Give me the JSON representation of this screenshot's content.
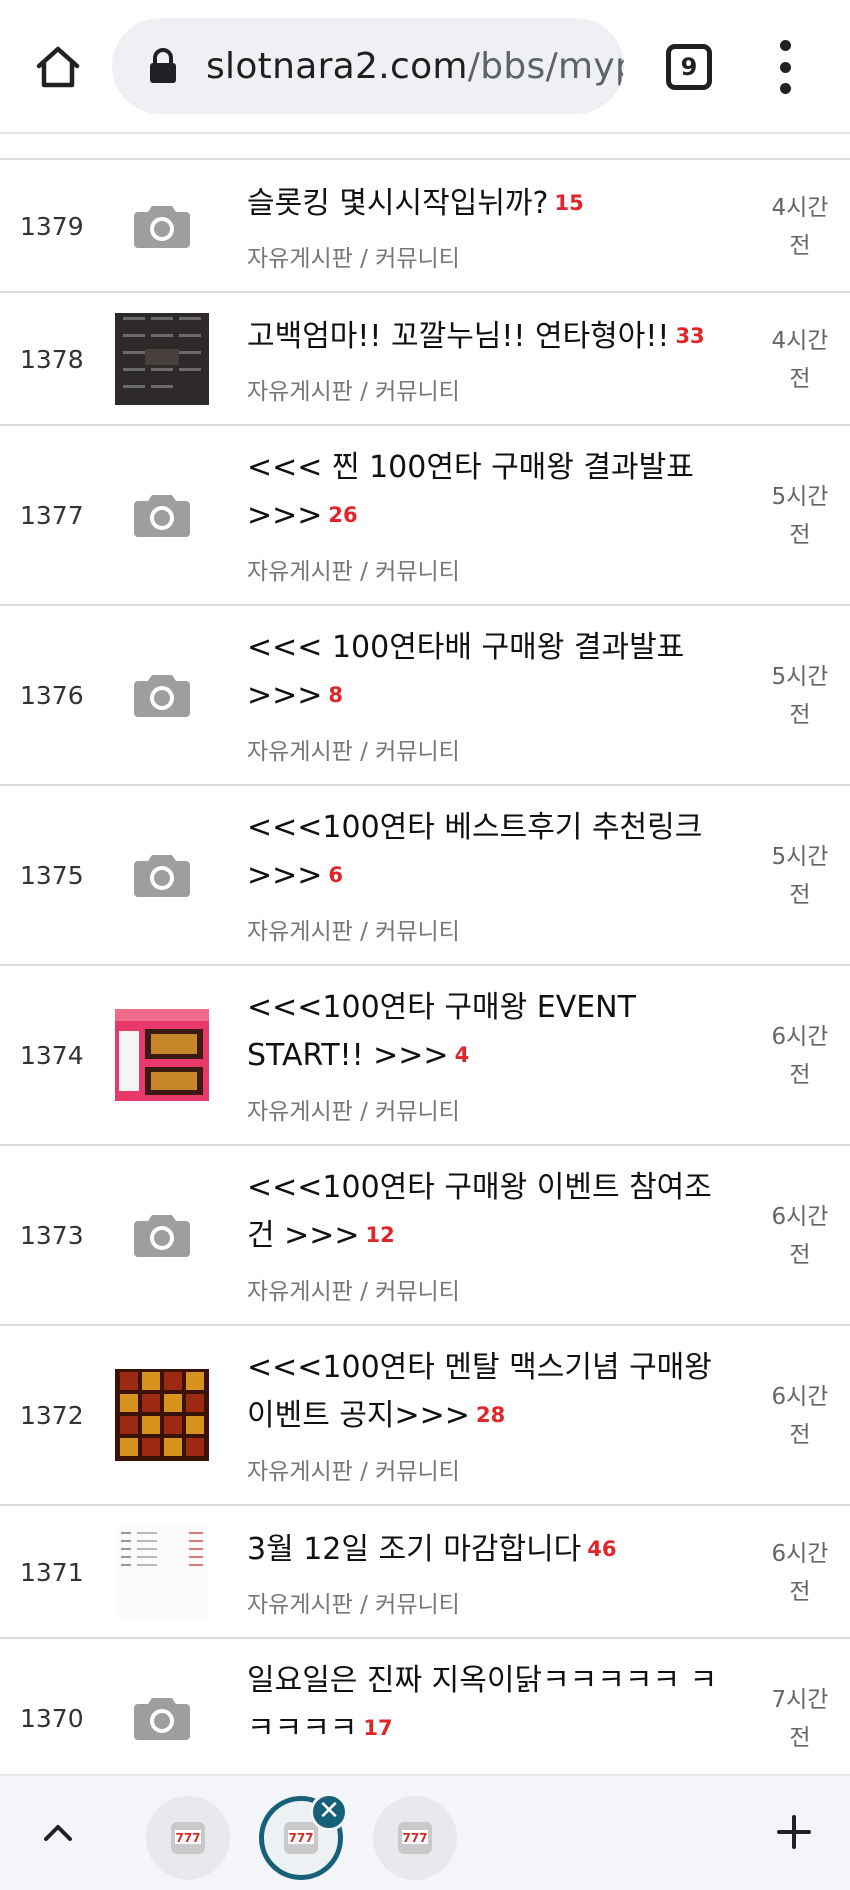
{
  "browser": {
    "url_host": "slotnara2.com",
    "url_path": "/bbs/myp",
    "tab_count": "9"
  },
  "posts": [
    {
      "num": "1379",
      "title": "슬롯킹 몇시시작입뉘까?",
      "comments": "15",
      "category": "자유게시판 / 커뮤니티",
      "time_l1": "4시간",
      "time_l2": "전",
      "thumb": "camera"
    },
    {
      "num": "1378",
      "title": "고백엄마!! 꼬깔누님!! 연타형아!!",
      "comments": "33",
      "category": "자유게시판 / 커뮤니티",
      "time_l1": "4시간",
      "time_l2": "전",
      "thumb": "dark-image"
    },
    {
      "num": "1377",
      "title": "<<< 찐 100연타 구매왕 결과발표 >>>",
      "comments": "26",
      "category": "자유게시판 / 커뮤니티",
      "time_l1": "5시간",
      "time_l2": "전",
      "thumb": "camera"
    },
    {
      "num": "1376",
      "title": "<<< 100연타배 구매왕 결과발표 >>>",
      "comments": "8",
      "category": "자유게시판 / 커뮤니티",
      "time_l1": "5시간",
      "time_l2": "전",
      "thumb": "camera"
    },
    {
      "num": "1375",
      "title": "<<<100연타 베스트후기 추천링크 >>>",
      "comments": "6",
      "category": "자유게시판 / 커뮤니티",
      "time_l1": "5시간",
      "time_l2": "전",
      "thumb": "camera"
    },
    {
      "num": "1374",
      "title": "<<<100연타 구매왕 EVENT START!! >>>",
      "comments": "4",
      "category": "자유게시판 / 커뮤니티",
      "time_l1": "6시간",
      "time_l2": "전",
      "thumb": "pink-image"
    },
    {
      "num": "1373",
      "title": "<<<100연타 구매왕 이벤트 참여조건 >>>",
      "comments": "12",
      "category": "자유게시판 / 커뮤니티",
      "time_l1": "6시간",
      "time_l2": "전",
      "thumb": "camera"
    },
    {
      "num": "1372",
      "title": "<<<100연타 멘탈 맥스기념 구매왕 이벤트 공지>>>",
      "comments": "28",
      "category": "자유게시판 / 커뮤니티",
      "time_l1": "6시간",
      "time_l2": "전",
      "thumb": "slot-image"
    },
    {
      "num": "1371",
      "title": "3월 12일 조기 마감합니다",
      "comments": "46",
      "category": "자유게시판 / 커뮤니티",
      "time_l1": "6시간",
      "time_l2": "전",
      "thumb": "list-image"
    },
    {
      "num": "1370",
      "title": "일요일은 진짜 지옥이닭ㅋㅋㅋㅋㅋ ㅋㅋㅋㅋㅋ",
      "comments": "17",
      "category": "자유게시판 / 커뮤니티",
      "time_l1": "7시간",
      "time_l2": "전",
      "thumb": "camera"
    }
  ],
  "bottom": {
    "close_symbol": "✕",
    "tab_icon": "slot-machine-icon"
  },
  "colors": {
    "comment_count": "#e0262b",
    "active_tab_ring": "#17607a"
  }
}
